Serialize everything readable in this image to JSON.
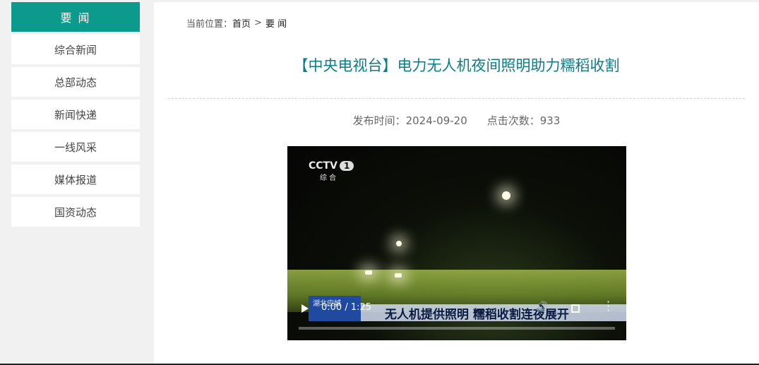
{
  "sidebar": {
    "header": "要 闻",
    "items": [
      {
        "label": "综合新闻"
      },
      {
        "label": "总部动态"
      },
      {
        "label": "新闻快递"
      },
      {
        "label": "一线风采"
      },
      {
        "label": "媒体报道"
      },
      {
        "label": "国资动态"
      }
    ]
  },
  "breadcrumb": {
    "prefix": "当前位置：",
    "home": "首页",
    "separator": ">",
    "current": "要 闻"
  },
  "article": {
    "title": "【中央电视台】电力无人机夜间照明助力糯稻收割",
    "publish_label": "发布时间：2024-09-20",
    "views_label": "点击次数：933"
  },
  "video": {
    "channel_logo": "CCTV",
    "channel_number": "1",
    "channel_sub": "综 合",
    "location_tag": "湖北应城",
    "caption": "无人机提供照明 糯稻收割连夜展开",
    "time": "0:00 / 1:25",
    "progress": 0.0,
    "icons": {
      "play": "play-icon",
      "volume": "volume-icon",
      "fullscreen": "fullscreen-icon",
      "more": "more-icon"
    }
  },
  "colors": {
    "accent": "#0b9a8b",
    "title": "#0a7e8a"
  }
}
